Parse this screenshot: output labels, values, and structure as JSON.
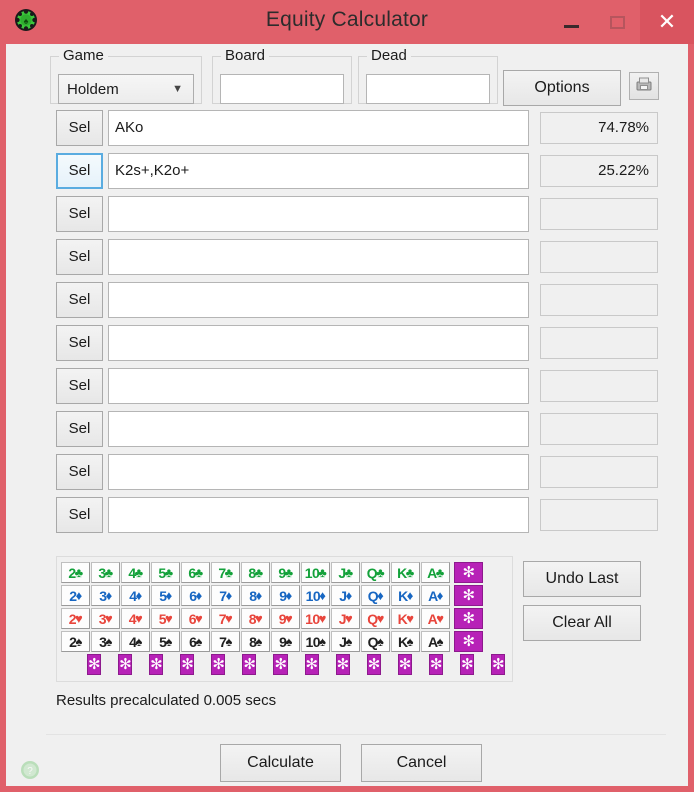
{
  "window": {
    "title": "Equity Calculator",
    "app_icon": "poker-chip-icon",
    "controls": {
      "minimize": "minimize-icon",
      "maximize": "maximize-icon",
      "close": "close-icon"
    }
  },
  "toolbar": {
    "game_label": "Game",
    "game_value": "Holdem",
    "game_options": [
      "Holdem"
    ],
    "board_label": "Board",
    "board_value": "",
    "board_placeholder": "",
    "dead_label": "Dead",
    "dead_value": "",
    "dead_placeholder": "",
    "options_label": "Options",
    "save_icon": "save-icon"
  },
  "rows": [
    {
      "sel_label": "Sel",
      "range": "AKo",
      "equity": "74.78%",
      "focused": false,
      "has_equity": true
    },
    {
      "sel_label": "Sel",
      "range": "K2s+,K2o+",
      "equity": "25.22%",
      "focused": true,
      "has_equity": true
    },
    {
      "sel_label": "Sel",
      "range": "",
      "equity": "",
      "focused": false,
      "has_equity": false
    },
    {
      "sel_label": "Sel",
      "range": "",
      "equity": "",
      "focused": false,
      "has_equity": false
    },
    {
      "sel_label": "Sel",
      "range": "",
      "equity": "",
      "focused": false,
      "has_equity": false
    },
    {
      "sel_label": "Sel",
      "range": "",
      "equity": "",
      "focused": false,
      "has_equity": false
    },
    {
      "sel_label": "Sel",
      "range": "",
      "equity": "",
      "focused": false,
      "has_equity": false
    },
    {
      "sel_label": "Sel",
      "range": "",
      "equity": "",
      "focused": false,
      "has_equity": false
    },
    {
      "sel_label": "Sel",
      "range": "",
      "equity": "",
      "focused": false,
      "has_equity": false
    },
    {
      "sel_label": "Sel",
      "range": "",
      "equity": "",
      "focused": false,
      "has_equity": false
    }
  ],
  "card_picker": {
    "ranks": [
      "2",
      "3",
      "4",
      "5",
      "6",
      "7",
      "8",
      "9",
      "10",
      "J",
      "Q",
      "K",
      "A"
    ],
    "suits": [
      {
        "key": "c",
        "name": "clubs",
        "glyph": "♣",
        "color": "#13a13a"
      },
      {
        "key": "d",
        "name": "diamonds",
        "glyph": "♦",
        "color": "#1766c2"
      },
      {
        "key": "h",
        "name": "hearts",
        "glyph": "♥",
        "color": "#e8453c"
      },
      {
        "key": "s",
        "name": "spades",
        "glyph": "♠",
        "color": "#202020"
      }
    ],
    "wildcard_glyph": "✻",
    "wildcard_color": "#b722b7",
    "wildcard_column_count": 4,
    "wildcard_row_count": 14,
    "undo_label": "Undo Last",
    "clear_label": "Clear All"
  },
  "status": {
    "text": "Results precalculated 0.005 secs"
  },
  "footer": {
    "calculate_label": "Calculate",
    "cancel_label": "Cancel",
    "help_icon": "help-icon"
  },
  "colors": {
    "titlebar": "#e0606a",
    "close_button": "#d9545f",
    "client_background": "#f0f0f0",
    "focus_border": "#5aace0"
  }
}
